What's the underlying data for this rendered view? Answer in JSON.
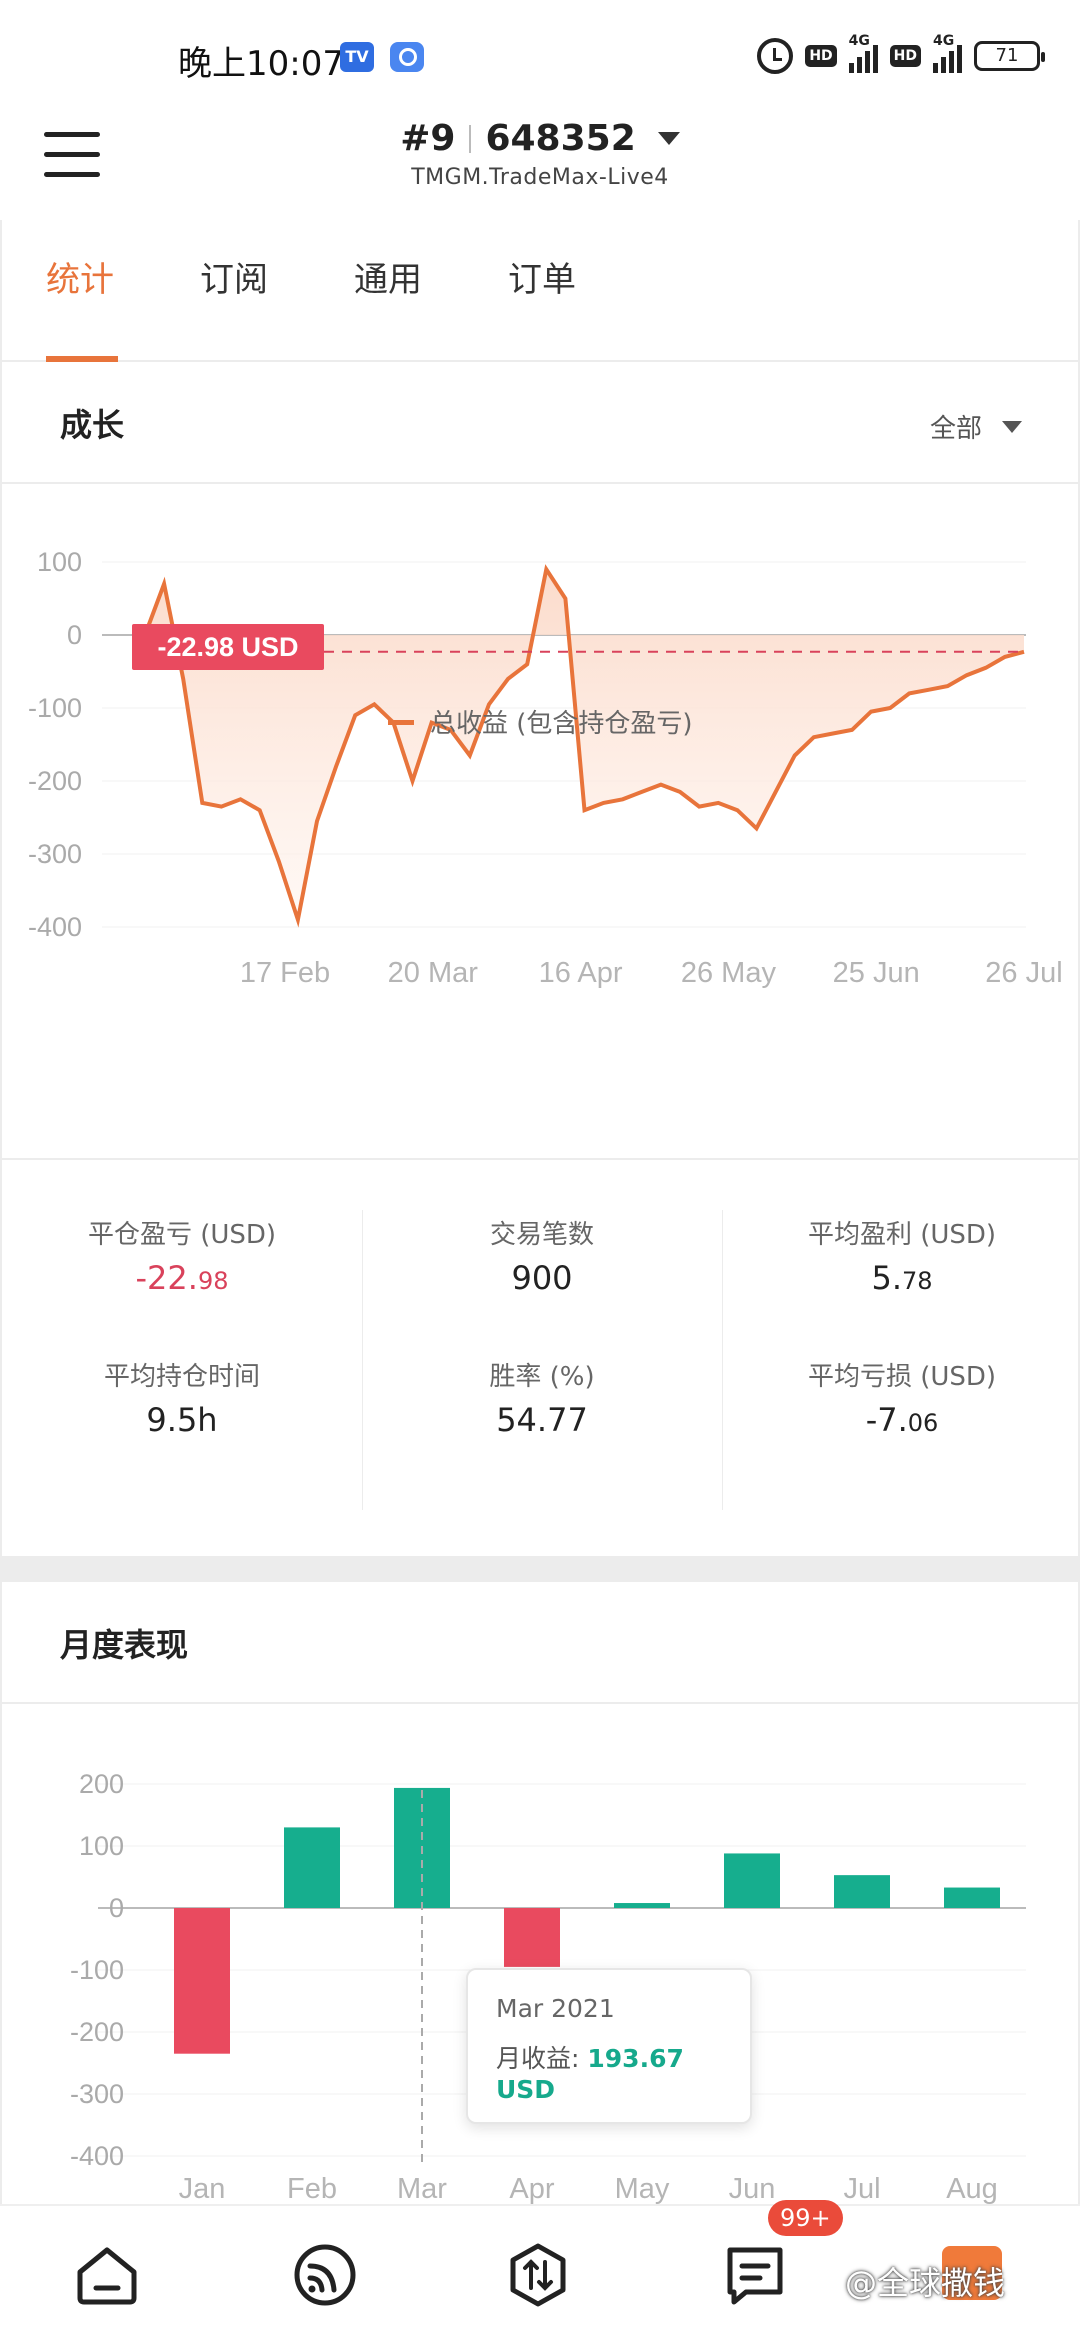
{
  "status_bar": {
    "time": "晚上10:07",
    "app_icon_1": "TV",
    "hd_label": "HD",
    "net_label": "4G",
    "battery": "71"
  },
  "header": {
    "account_num": "#9",
    "account_id": "648352",
    "server": "TMGM.TradeMax-Live4"
  },
  "tabs": [
    {
      "label": "统计",
      "active": true
    },
    {
      "label": "订阅"
    },
    {
      "label": "通用"
    },
    {
      "label": "订单"
    }
  ],
  "growth": {
    "title": "成长",
    "filter_label": "全部",
    "legend": "总收益 (包含持仓盈亏)",
    "current_label": "-22.98 USD"
  },
  "stats": {
    "closed_pl_label": "平仓盈亏 (USD)",
    "closed_pl_int": "-22.",
    "closed_pl_dec": "98",
    "trades_label": "交易笔数",
    "trades_value": "900",
    "avg_profit_label": "平均盈利 (USD)",
    "avg_profit_int": "5.",
    "avg_profit_dec": "78",
    "hold_time_label": "平均持仓时间",
    "hold_time_value": "9.5h",
    "win_rate_label": "胜率 (%)",
    "win_rate_value": "54.77",
    "avg_loss_label": "平均亏损 (USD)",
    "avg_loss_int": "-7.",
    "avg_loss_dec": "06"
  },
  "monthly": {
    "title": "月度表现",
    "tooltip_title": "Mar 2021",
    "tooltip_label": "月收益:",
    "tooltip_value": "193.67 USD"
  },
  "bottom_nav": {
    "badge": "99+",
    "watermark": "@全球撒钱"
  },
  "colors": {
    "accent": "#e8743b",
    "positive": "#16ae8e",
    "negative": "#e94a5f"
  },
  "chart_data": [
    {
      "type": "area",
      "title": "",
      "ylim": [
        -400,
        100
      ],
      "yticks": [
        "100",
        "0",
        "-100",
        "-200",
        "-300",
        "-400"
      ],
      "xticks": [
        "17 Feb",
        "20 Mar",
        "16 Apr",
        "26 May",
        "25 Jun",
        "26 Jul"
      ],
      "series": [
        {
          "name": "总收益 (包含持仓盈亏)",
          "values": [
            0,
            70,
            -60,
            -230,
            -235,
            -225,
            -240,
            -310,
            -390,
            -255,
            -180,
            -110,
            -95,
            -120,
            -200,
            -120,
            -130,
            -165,
            -95,
            -60,
            -40,
            90,
            50,
            -240,
            -230,
            -225,
            -215,
            -205,
            -215,
            -235,
            -230,
            -240,
            -265,
            -215,
            -165,
            -140,
            -135,
            -130,
            -105,
            -100,
            -80,
            -75,
            -70,
            -55,
            -45,
            -30,
            -22.98
          ]
        }
      ]
    },
    {
      "type": "bar",
      "title": "",
      "ylim": [
        -400,
        200
      ],
      "yticks": [
        "200",
        "100",
        "0",
        "-100",
        "-200",
        "-300",
        "-400"
      ],
      "categories": [
        "Jan",
        "Feb",
        "Mar",
        "Apr",
        "May",
        "Jun",
        "Jul",
        "Aug"
      ],
      "values": [
        -235,
        130,
        193.67,
        -95,
        8,
        88,
        53,
        33
      ]
    }
  ]
}
